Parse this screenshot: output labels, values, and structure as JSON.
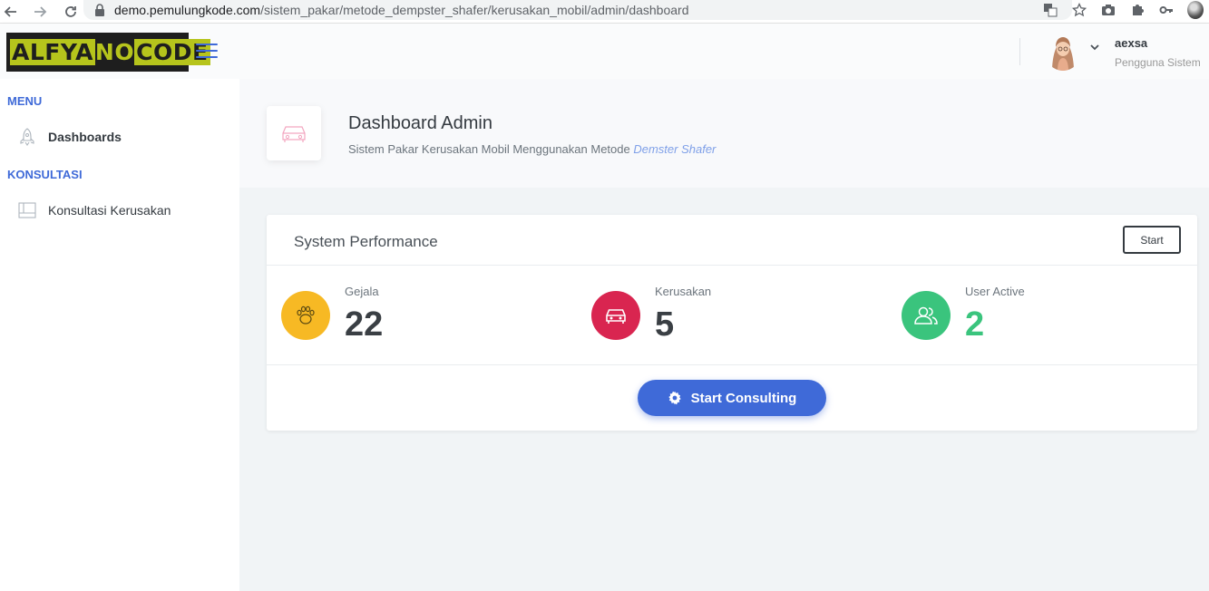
{
  "browser": {
    "url_host": "demo.pemulungkode.com",
    "url_path": "/sistem_pakar/metode_dempster_shafer/kerusakan_mobil/admin/dashboard"
  },
  "header": {
    "logo": {
      "part1": "ALFYA",
      "part2": "NO",
      "part3": "CODE"
    },
    "user_name": "aexsa",
    "user_role": "Pengguna Sistem"
  },
  "sidebar": {
    "sections": [
      {
        "heading": "MENU",
        "items": [
          {
            "label": "Dashboards",
            "icon": "rocket-icon"
          }
        ]
      },
      {
        "heading": "KONSULTASI",
        "items": [
          {
            "label": "Konsultasi Kerusakan",
            "icon": "browser-window-icon"
          }
        ]
      }
    ]
  },
  "page_title": {
    "heading": "Dashboard Admin",
    "subtitle": "Sistem Pakar Kerusakan Mobil Menggunakan Metode",
    "subtitle_emphasis": "Demster Shafer",
    "icon": "car-icon"
  },
  "card": {
    "title": "System Performance",
    "start_label": "Start",
    "stats": [
      {
        "label": "Gejala",
        "value": "22",
        "icon": "paw-icon",
        "color": "#f7b924"
      },
      {
        "label": "Kerusakan",
        "value": "5",
        "icon": "car-icon",
        "color": "#d92550"
      },
      {
        "label": "User Active",
        "value": "2",
        "icon": "users-icon",
        "color": "#3ac47d"
      }
    ],
    "consult_label": "Start Consulting"
  },
  "colors": {
    "primary": "#3f6ad8",
    "logo_green": "#b6c41c",
    "success": "#3ac47d"
  }
}
